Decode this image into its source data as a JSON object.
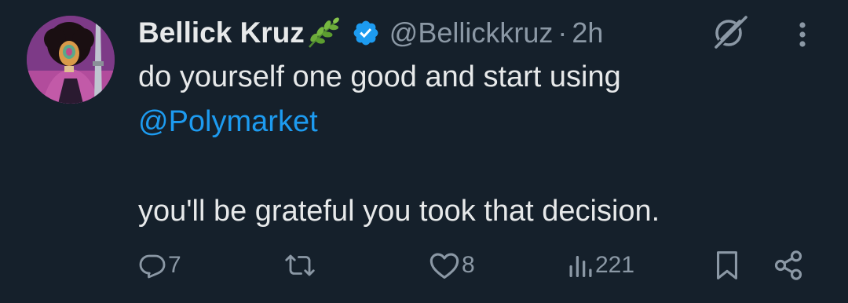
{
  "tweet": {
    "display_name": "Bellick Kruz",
    "handle": "@Bellickkruz",
    "separator": "·",
    "time": "2h",
    "text_line1": "do yourself one good and start using",
    "mention": "@Polymarket",
    "text_line3": "you'll be grateful you took that decision.",
    "name_emoji": "herb-emoji",
    "verified": true
  },
  "actions": {
    "replies": "7",
    "reposts": "",
    "likes": "8",
    "views": "221"
  },
  "colors": {
    "background": "#15202b",
    "text": "#e7e9ea",
    "secondary": "#8b98a5",
    "accent": "#1d9bf0"
  }
}
